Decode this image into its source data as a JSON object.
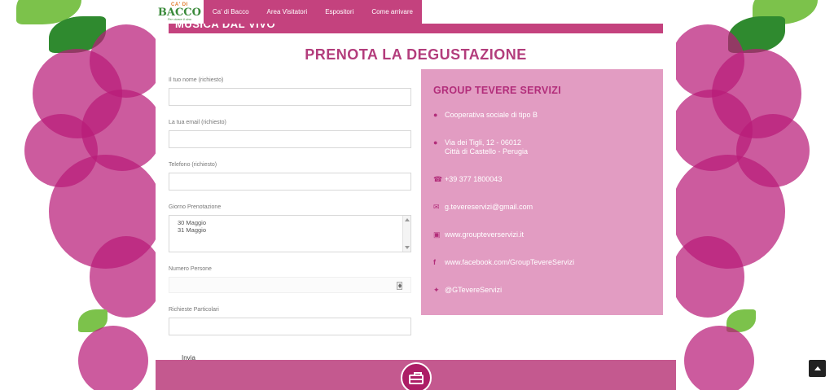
{
  "logo": {
    "top": "CA' DI",
    "main": "BACCO",
    "tagline": "Per vivere il vino"
  },
  "nav": {
    "items": [
      "Ca' di Bacco",
      "Area Visitatori",
      "Espositori",
      "Come arrivare"
    ]
  },
  "section": {
    "partial_title": "MUSICA DAL VIVO"
  },
  "page": {
    "title": "PRENOTA LA DEGUSTAZIONE"
  },
  "form": {
    "name_label": "Il tuo nome (richiesto)",
    "email_label": "La tua email (richiesto)",
    "phone_label": "Telefono (richiesto)",
    "day_label": "Giorno Prenotazione",
    "day_options": [
      "30 Maggio",
      "31 Maggio"
    ],
    "people_label": "Numero Persone",
    "notes_label": "Richieste Particolari",
    "submit_label": "Invia"
  },
  "contact": {
    "title": "GROUP TEVERE SERVIZI",
    "type": "Cooperativa sociale di tipo B",
    "address_line1": "Via dei Tigli, 12 - 06012",
    "address_line2": "Città di Castello - Perugia",
    "phone": "+39 377 1800043",
    "email": "g.tevereservizi@gmail.com",
    "website": "www.groupteverservizi.it",
    "facebook": "www.facebook.com/GroupTevereServizi",
    "twitter": "@GTevereServizi"
  },
  "icons": {
    "users": "users-icon",
    "map": "map-marker-icon",
    "phone": "phone-icon",
    "email": "envelope-icon",
    "web": "monitor-icon",
    "facebook": "facebook-icon",
    "twitter": "twitter-icon",
    "footer": "briefcase-icon",
    "back_top": "chevron-up-icon"
  },
  "colors": {
    "brand": "#c4427e",
    "panel": "#e29cc2",
    "title": "#b33d7c"
  }
}
